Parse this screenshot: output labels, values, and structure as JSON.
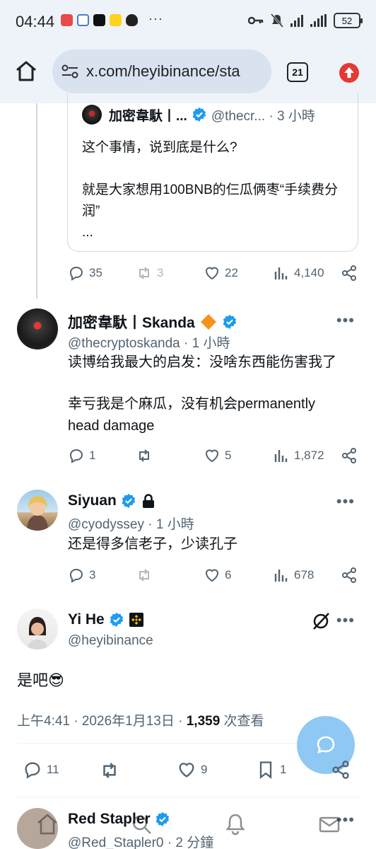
{
  "status": {
    "time": "04:44",
    "more": "···",
    "battery": "52"
  },
  "browser": {
    "url": "x.com/heyibinance/sta",
    "tab_count": "21"
  },
  "quote": {
    "author_name": "加密韋馱丨...",
    "author_handle": "@thecr... · 3 小時",
    "text": [
      "这个事情，说到底是什么?",
      "就是大家想用100BNB的仨瓜俩枣“手续费分润”",
      "..."
    ],
    "actions": {
      "replies": "35",
      "reposts": "3",
      "likes": "22",
      "views": "4,140"
    }
  },
  "replies": [
    {
      "name": "加密韋馱丨Skanda",
      "handle": "@thecryptoskanda · 1 小時",
      "text": [
        "读博给我最大的启发：没啥东西能伤害我了",
        "幸亏我是个麻瓜，没有机会permanently head damage"
      ],
      "more": "•••",
      "actions": {
        "replies": "1",
        "reposts": "",
        "likes": "5",
        "views": "1,872"
      }
    },
    {
      "name": "Siyuan",
      "handle": "@cyodyssey · 1 小時",
      "text": [
        "还是得多信老子，少读孔子"
      ],
      "more": "•••",
      "actions": {
        "replies": "3",
        "reposts": "",
        "likes": "6",
        "views": "678"
      }
    }
  ],
  "main_tweet": {
    "name": "Yi He",
    "handle": "@heyibinance",
    "more": "•••",
    "text": "是吧😎",
    "meta_time": "上午4:41 · 2026年1月13日 · ",
    "meta_views": "1,359",
    "meta_views_label": " 次查看",
    "actions": {
      "replies": "11",
      "reposts": "",
      "likes": "9",
      "bookmarks": "1"
    }
  },
  "next_reply": {
    "name": "Red Stapler",
    "handle": "@Red_Stapler0 · 2 分鐘",
    "more": "•••"
  },
  "colors": {
    "verified": "#1d9bf0",
    "binance": "#f0b90b",
    "text_secondary": "#536471",
    "fab": "#8ec8f3"
  }
}
